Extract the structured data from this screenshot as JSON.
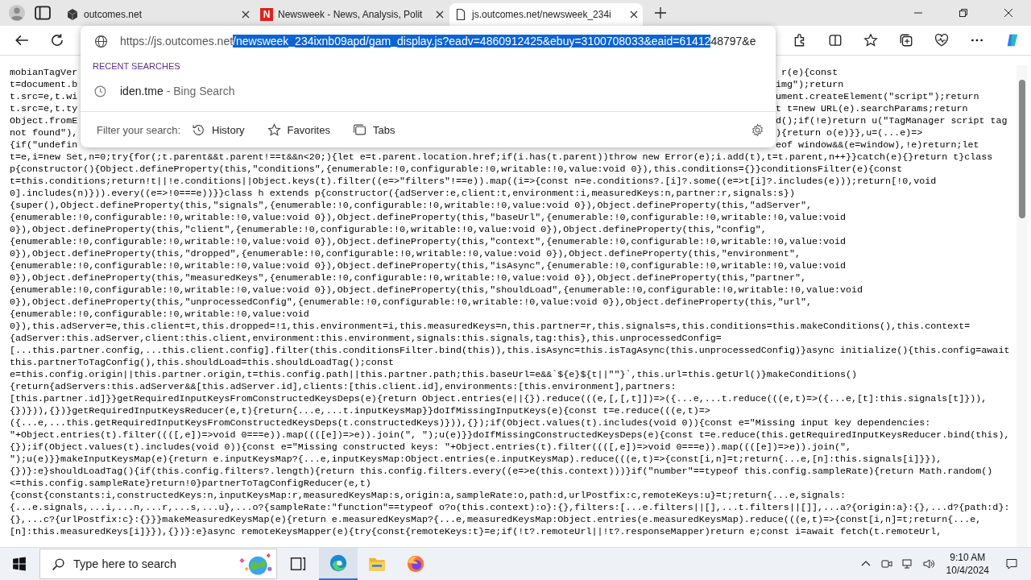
{
  "tabs": [
    {
      "title": "outcomes.net",
      "kind": "cube",
      "selected": false
    },
    {
      "title": "Newsweek - News, Analysis, Polit",
      "kind": "letter",
      "icon_text": "N",
      "selected": false
    },
    {
      "title": "js.outcomes.net/newsweek_234i",
      "kind": "page",
      "selected": true
    }
  ],
  "address_bar": {
    "url_parts": [
      {
        "text": "https://js.outcomes.net",
        "selected": false
      },
      {
        "text": "/newsweek_234ixnb09apd/gam_display.js?eadv=4860912425&ebuy=3100708033&eaid=61412",
        "selected": true
      },
      {
        "text": "48797&e",
        "selected": false
      }
    ]
  },
  "omnibox_dropdown": {
    "section_heading": "RECENT SEARCHES",
    "suggestions": [
      {
        "text": "iden.tme",
        "source": "- Bing Search"
      }
    ],
    "filter_label": "Filter your search:",
    "filters": [
      {
        "label": "History",
        "kind": "history"
      },
      {
        "label": "Favorites",
        "kind": "star"
      },
      {
        "label": "Tabs",
        "kind": "tabs"
      }
    ]
  },
  "code_lines": [
    {
      "left": "mobianTagVer",
      "right": " r(e){const"
    },
    {
      "left": "t=document.b",
      "right": "img\");return"
    },
    {
      "left": "t.src=e,t.wi",
      "right": "ument.createElement(\"script\");return"
    },
    {
      "left": "t.src=e,t.ty",
      "right": "t t=new URL(e).searchParams;return"
    },
    {
      "left": "Object.fromE",
      "right": "d();if(!e)return u(\"TagManager script tag"
    },
    {
      "left": "not found\"),",
      "right": "){return o(e)}},u=(...e)=>"
    },
    {
      "left": "{if(\"undefin",
      "right": "eof window&&(e=window),!e)return;let"
    },
    {
      "text": "t=e,i=new Set,n=0;try{for(;t.parent&&t.parent!==t&&n<20;){let e=t.parent.location.href;if(i.has(t.parent))throw new Error(e);i.add(t),t=t.parent,n++}}catch(e){}return t}class"
    },
    {
      "text": "p{constructor(){Object.defineProperty(this,\"conditions\",{enumerable:!0,configurable:!0,writable:!0,value:void 0}),this.conditions={}}conditionsFilter(e){const"
    },
    {
      "text": "t=this.conditions;return!t||!e.conditions||Object.keys(t).filter((e=>\"filters\"!==e)).map((i=>{const n=e.conditions?.[i]?.some((e=>t[i]?.includes(e)));return[!0,void"
    },
    {
      "text": "0].includes(n)})).every((e=>!0===e))}}class h extends p{constructor({adServer:e,client:t,environment:i,measuredKeys:n,partner:r,signals:s})"
    },
    {
      "text": "{super(),Object.defineProperty(this,\"signals\",{enumerable:!0,configurable:!0,writable:!0,value:void 0}),Object.defineProperty(this,\"adServer\","
    },
    {
      "text": "{enumerable:!0,configurable:!0,writable:!0,value:void 0}),Object.defineProperty(this,\"baseUrl\",{enumerable:!0,configurable:!0,writable:!0,value:void"
    },
    {
      "text": "0}),Object.defineProperty(this,\"client\",{enumerable:!0,configurable:!0,writable:!0,value:void 0}),Object.defineProperty(this,\"config\","
    },
    {
      "text": "{enumerable:!0,configurable:!0,writable:!0,value:void 0}),Object.defineProperty(this,\"context\",{enumerable:!0,configurable:!0,writable:!0,value:void"
    },
    {
      "text": "0}),Object.defineProperty(this,\"dropped\",{enumerable:!0,configurable:!0,writable:!0,value:void 0}),Object.defineProperty(this,\"environment\","
    },
    {
      "text": "{enumerable:!0,configurable:!0,writable:!0,value:void 0}),Object.defineProperty(this,\"isAsync\",{enumerable:!0,configurable:!0,writable:!0,value:void"
    },
    {
      "text": "0}),Object.defineProperty(this,\"measuredKeys\",{enumerable:!0,configurable:!0,writable:!0,value:void 0}),Object.defineProperty(this,\"partner\","
    },
    {
      "text": "{enumerable:!0,configurable:!0,writable:!0,value:void 0}),Object.defineProperty(this,\"shouldLoad\",{enumerable:!0,configurable:!0,writable:!0,value:void"
    },
    {
      "text": "0}),Object.defineProperty(this,\"unprocessedConfig\",{enumerable:!0,configurable:!0,writable:!0,value:void 0}),Object.defineProperty(this,\"url\","
    },
    {
      "text": "{enumerable:!0,configurable:!0,writable:!0,value:void"
    },
    {
      "text": "0}),this.adServer=e,this.client=t,this.dropped=!1,this.environment=i,this.measuredKeys=n,this.partner=r,this.signals=s,this.conditions=this.makeConditions(),this.context="
    },
    {
      "text": "{adServer:this.adServer,client:this.client,environment:this.environment,signals:this.signals,tag:this},this.unprocessedConfig="
    },
    {
      "text": "[...this.partner.config,...this.client.config].filter(this.conditionsFilter.bind(this)),this.isAsync=this.isTagAsync(this.unprocessedConfig)}async initialize(){this.config=await"
    },
    {
      "text": "this.partnerToTagConfig(),this.shouldLoad=this.shouldLoadTag();const"
    },
    {
      "text": "e=this.config.origin||this.partner.origin,t=this.config.path||this.partner.path;this.baseUrl=e&&`${e}${t||\"\"}`,this.url=this.getUrl()}makeConditions()"
    },
    {
      "text": "{return{adServers:this.adServer&&[this.adServer.id],clients:[this.client.id],environments:[this.environment],partners:"
    },
    {
      "text": "[this.partner.id]}}getRequiredInputKeysFromConstructedKeysDeps(e){return Object.entries(e||{}).reduce(((e,[,[,t]])=>({...e,...t.reduce(((e,t)=>({...e,[t]:this.signals[t]})),"
    },
    {
      "text": "{})})),{})}getRequiredInputKeysReducer(e,t){return{...e,...t.inputKeysMap}}doIfMissingInputKeys(e){const t=e.reduce(((e,t)=>"
    },
    {
      "text": "({...e,...this.getRequiredInputKeysFromConstructedKeysDeps(t.constructedKeys)})),{});if(Object.values(t).includes(void 0)){const e=\"Missing input key dependencies:"
    },
    {
      "text": "\"+Object.entries(t).filter((([,e])=>void 0===e)).map((([e])=>e)).join(\", \");u(e)}}doIfMissingConstructedKeysDeps(e){const t=e.reduce(this.getRequiredInputKeysReducer.bind(this),"
    },
    {
      "text": "{});if(Object.values(t).includes(void 0)){const e=\"Missing constructed keys: \"+Object.entries(t).filter((([,e])=>void 0===e)).map((([e])=>e)).join(\","
    },
    {
      "text": "\");u(e)}}makeInputKeysMap(e){return e.inputKeysMap?{...e,inputKeysMap:Object.entries(e.inputKeysMap).reduce(((e,t)=>{const[i,n]=t;return{...e,[n]:this.signals[i]}}),"
    },
    {
      "text": "{})}:e}shouldLoadTag(){if(this.config.filters?.length){return this.config.filters.every((e=>e(this.context)))}if(\"number\"==typeof this.config.sampleRate){return Math.random()"
    },
    {
      "text": "<=this.config.sampleRate}return!0}partnerToTagConfigReducer(e,t)"
    },
    {
      "text": "{const{constants:i,constructedKeys:n,inputKeysMap:r,measuredKeysMap:s,origin:a,sampleRate:o,path:d,urlPostfix:c,remoteKeys:u}=t;return{...e,signals:"
    },
    {
      "text": "{...e.signals,...i,...n,...r,...s,...u},...o?{sampleRate:\"function\"==typeof o?o(this.context):o}:{},filters:[...e.filters||[],...t.filters||[]],...a?{origin:a}:{},...d?{path:d}:"
    },
    {
      "text": "{},...c?{urlPostfix:c}:{}}}makeMeasuredKeysMap(e){return e.measuredKeysMap?{...e,measuredKeysMap:Object.entries(e.measuredKeysMap).reduce(((e,t)=>{const[i,n]=t;return{...e,"
    },
    {
      "text": "[n]:this.measuredKeys[i]}}),{})}:e}async remoteKeysMapper(e){try{const{remoteKeys:t}=e;if(!t?.remoteUrl||!t?.responseMapper)return e;const i=await fetch(t.remoteUrl,"
    }
  ],
  "taskbar": {
    "search_placeholder": "Type here to search",
    "time": "9:10 AM",
    "date": "10/4/2024"
  }
}
